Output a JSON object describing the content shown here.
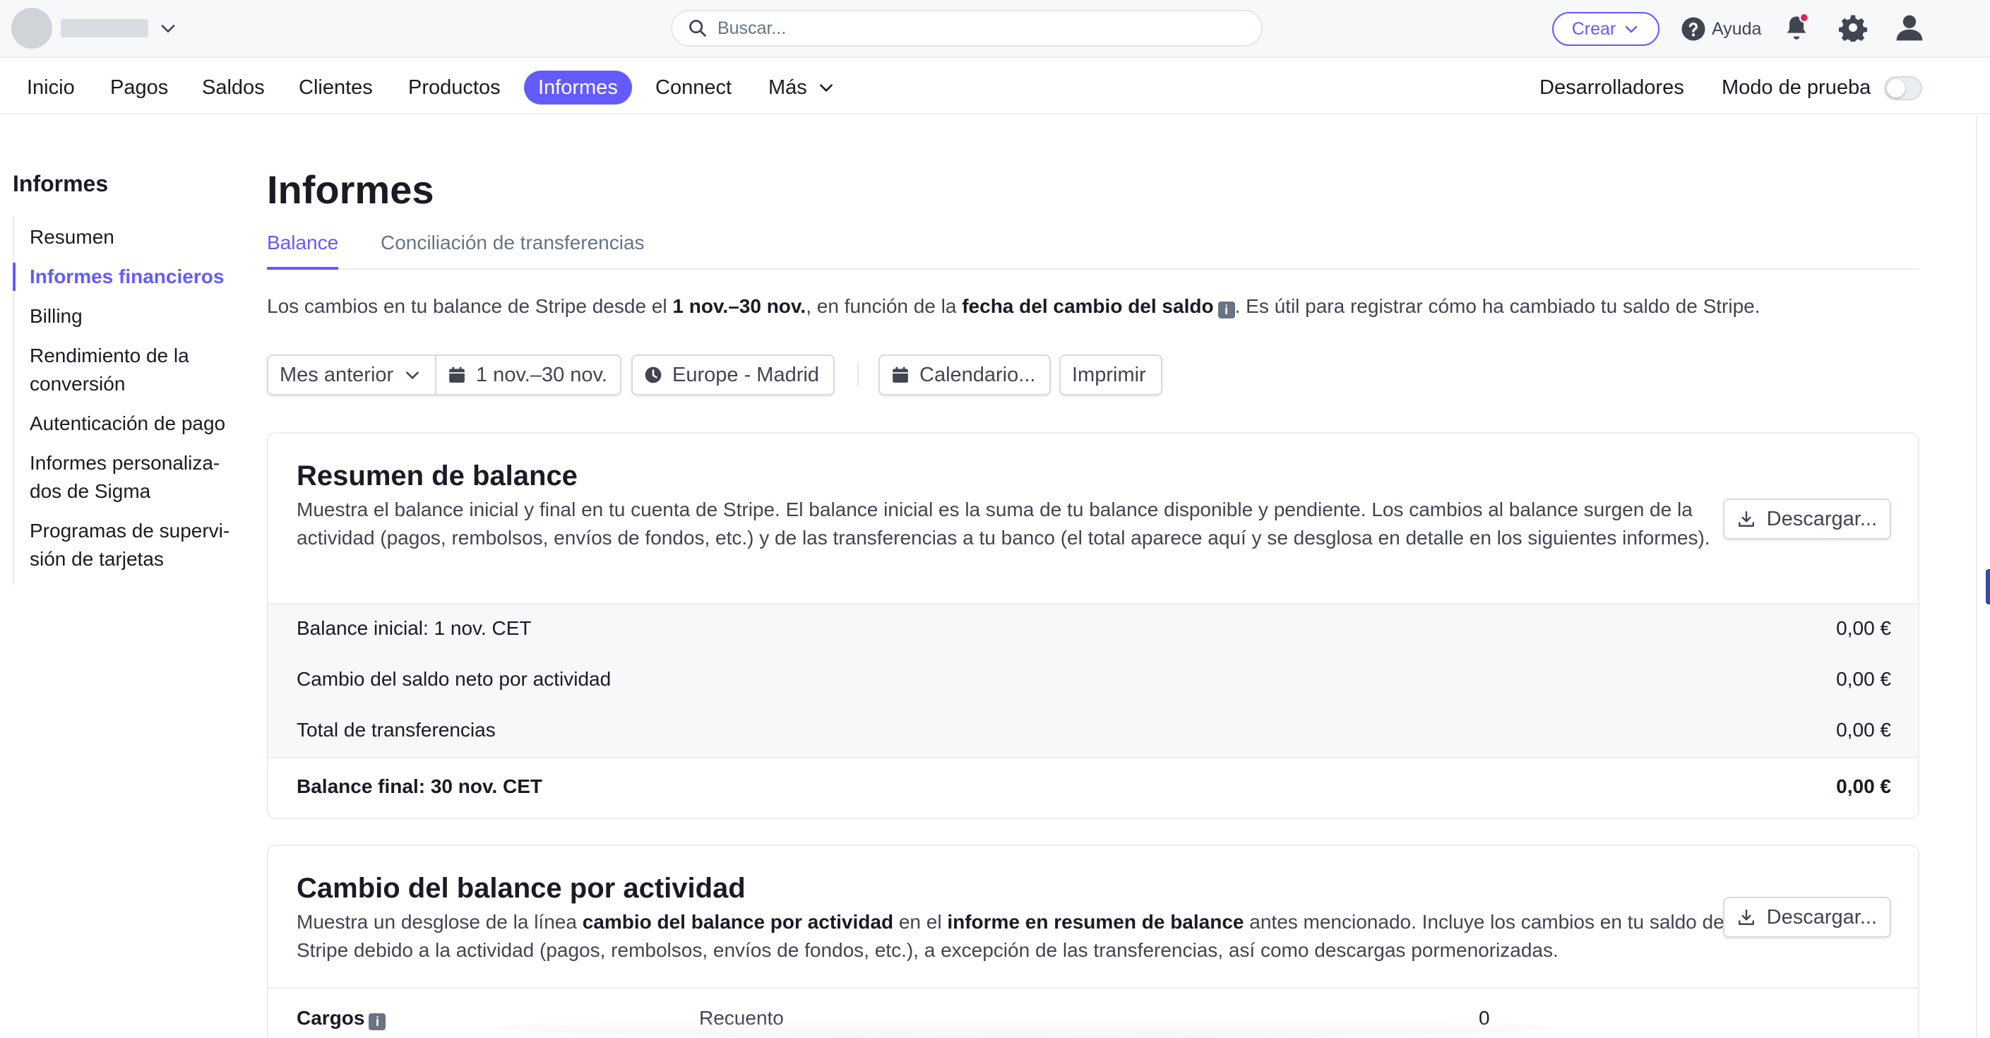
{
  "topbar": {
    "search_placeholder": "Buscar...",
    "create_label": "Crear",
    "help_label": "Ayuda",
    "notification_dot_color": "#e0245e"
  },
  "nav": {
    "items": [
      "Inicio",
      "Pagos",
      "Saldos",
      "Clientes",
      "Productos",
      "Informes",
      "Connect",
      "Más"
    ],
    "active": "Informes",
    "developers_label": "Desarrolladores",
    "test_mode_label": "Modo de prueba",
    "test_mode_on": false
  },
  "sidebar": {
    "title": "Informes",
    "items": [
      {
        "label_lines": [
          "Resumen"
        ]
      },
      {
        "label_lines": [
          "Informes financieros"
        ],
        "active": true
      },
      {
        "label_lines": [
          "Billing"
        ]
      },
      {
        "label_lines": [
          "Rendimiento de la",
          "conversión"
        ]
      },
      {
        "label_lines": [
          "Autenticación de pago"
        ]
      },
      {
        "label_lines": [
          "Informes personaliza-",
          "dos de Sigma"
        ]
      },
      {
        "label_lines": [
          "Programas de supervi-",
          "sión de tarjetas"
        ]
      }
    ]
  },
  "main": {
    "title": "Informes",
    "tabs": [
      "Balance",
      "Conciliación de transferencias"
    ],
    "active_tab": "Balance",
    "description": {
      "p1": "Los cambios en tu balance de Stripe desde el ",
      "b1": "1 nov.–30 nov.",
      "p2": ", en función de la ",
      "b2": "fecha del cambio del saldo",
      "p3": ". Es útil para registrar cómo ha cambiado tu saldo de Stripe."
    },
    "filters": {
      "period": "Mes anterior",
      "date_range": "1 nov.–30 nov.",
      "timezone": "Europe - Madrid",
      "calendar": "Calendario...",
      "print": "Imprimir"
    }
  },
  "balance_summary": {
    "title": "Resumen de balance",
    "description": "Muestra el balance inicial y final en tu cuenta de Stripe. El balance inicial es la suma de tu balance disponible y pendiente. Los cambios al balance surgen de la actividad (pagos, rembolsos, envíos de fondos, etc.) y de las transferencias a tu banco (el total aparece aquí y se desglosa en detalle en los siguientes informes).",
    "download_label": "Descargar...",
    "rows": [
      {
        "label": "Balance inicial: 1 nov. CET",
        "value": "0,00 €"
      },
      {
        "label": "Cambio del saldo neto por actividad",
        "value": "0,00 €"
      },
      {
        "label": "Total de transferencias",
        "value": "0,00 €"
      }
    ],
    "total": {
      "label": "Balance final: 30 nov. CET",
      "value": "0,00 €"
    }
  },
  "activity_change": {
    "title": "Cambio del balance por actividad",
    "description": {
      "p1": "Muestra un desglose de la línea ",
      "b1": "cambio del balance por actividad",
      "p2": " en el ",
      "b2": "informe en resumen de balance",
      "p3": " antes mencionado. Incluye los cambios en tu saldo de Stripe debido a la actividad (pagos, rembolsos, envíos de fondos, etc.), a excepción de las transferencias, así como descargas pormenorizadas."
    },
    "download_label": "Descargar...",
    "first_row": {
      "label": "Cargos",
      "count_label": "Recuento",
      "count_value": "0"
    }
  },
  "colors": {
    "accent": "#635bff",
    "text": "#1a1b25",
    "muted": "#687385",
    "border": "#ebeef1"
  }
}
